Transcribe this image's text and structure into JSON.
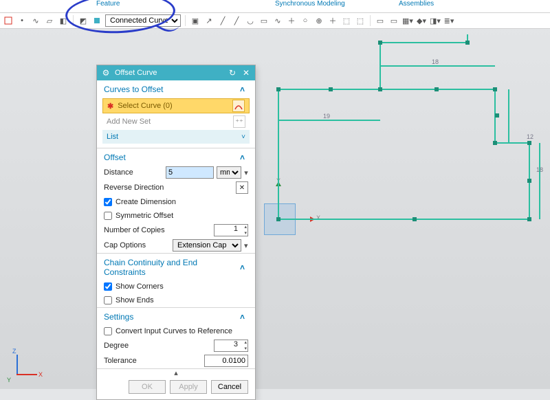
{
  "ribbon": {
    "tab_feature": "Feature",
    "tab_sync": "Synchronous Modeling",
    "tab_assemblies": "Assemblies"
  },
  "toolbar": {
    "curve_rule_selected": "Connected Curves"
  },
  "annotation": {
    "note": "user-circled"
  },
  "dialog": {
    "title": "Offset Curve",
    "sections": {
      "curves": {
        "title": "Curves to Offset",
        "select_curve": "Select Curve (0)",
        "add_new_set": "Add New Set",
        "list": "List"
      },
      "offset": {
        "title": "Offset",
        "distance_label": "Distance",
        "distance_value": "5",
        "distance_unit": "mm",
        "reverse_direction": "Reverse Direction",
        "create_dimension": "Create Dimension",
        "symmetric_offset": "Symmetric Offset",
        "num_copies_label": "Number of Copies",
        "num_copies": "1",
        "cap_options_label": "Cap Options",
        "cap_options_value": "Extension Cap"
      },
      "chain": {
        "title": "Chain Continuity and End Constraints",
        "show_corners": "Show Corners",
        "show_ends": "Show Ends"
      },
      "settings": {
        "title": "Settings",
        "convert_ref": "Convert Input Curves to Reference",
        "degree_label": "Degree",
        "degree": "3",
        "tolerance_label": "Tolerance",
        "tolerance": "0.0100"
      }
    },
    "buttons": {
      "ok": "OK",
      "apply": "Apply",
      "cancel": "Cancel"
    }
  },
  "canvas": {
    "axis_x": "X",
    "axis_y": "Y",
    "axis_z": "Z",
    "dims": {
      "d1": "19",
      "d2": "18",
      "d3": "12",
      "d4": "18"
    }
  }
}
